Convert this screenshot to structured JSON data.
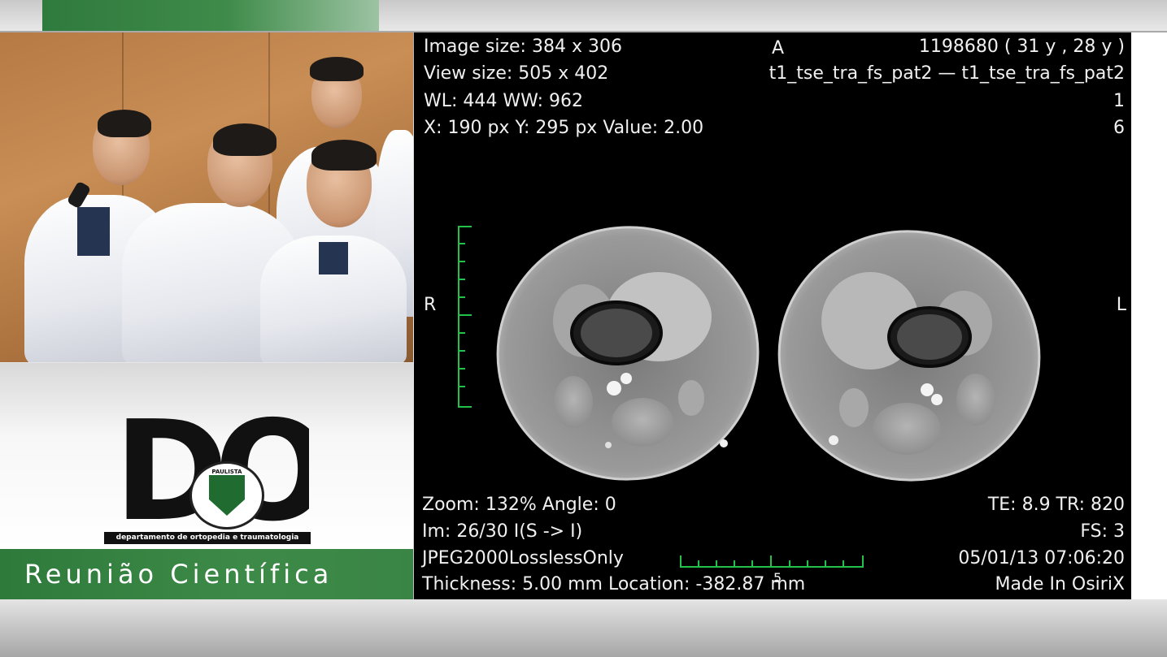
{
  "logo": {
    "letters": "DOT",
    "seal_text": "PAULISTA",
    "department": "departamento de ortopedia e traumatologia"
  },
  "banner": {
    "title": "Reunião Científica"
  },
  "viewer": {
    "top_left": {
      "image_size": "Image size: 384 x 306",
      "view_size": "View size: 505 x 402",
      "wl_ww": "WL: 444 WW: 962",
      "cursor": "X: 190 px Y: 295 px Value: 2.00"
    },
    "top_center": {
      "orientation_top": "A"
    },
    "top_right": {
      "patient": "1198680 (  31 y ,  28 y )",
      "series": "t1_tse_tra_fs_pat2 — t1_tse_tra_fs_pat2",
      "line3": "1",
      "line4": "6"
    },
    "side_labels": {
      "left": "R",
      "right": "L"
    },
    "bottom_left": {
      "zoom_angle": "Zoom: 132%  Angle: 0",
      "image_index": "Im: 26/30  I(S -> I)",
      "compression": "JPEG2000LosslessOnly",
      "thickness_location": "Thickness: 5.00 mm Location: -382.87 mm"
    },
    "bottom_center": {
      "scale_label": "5"
    },
    "bottom_right": {
      "te_tr": "TE:  8.9 TR:  820",
      "fs": "FS:  3",
      "datetime": "05/01/13 07:06:20",
      "made_in": "Made In OsiriX"
    }
  },
  "colors": {
    "brand_green": "#2e7a3b",
    "scale_green": "#22c24a",
    "viewer_bg": "#000000"
  }
}
